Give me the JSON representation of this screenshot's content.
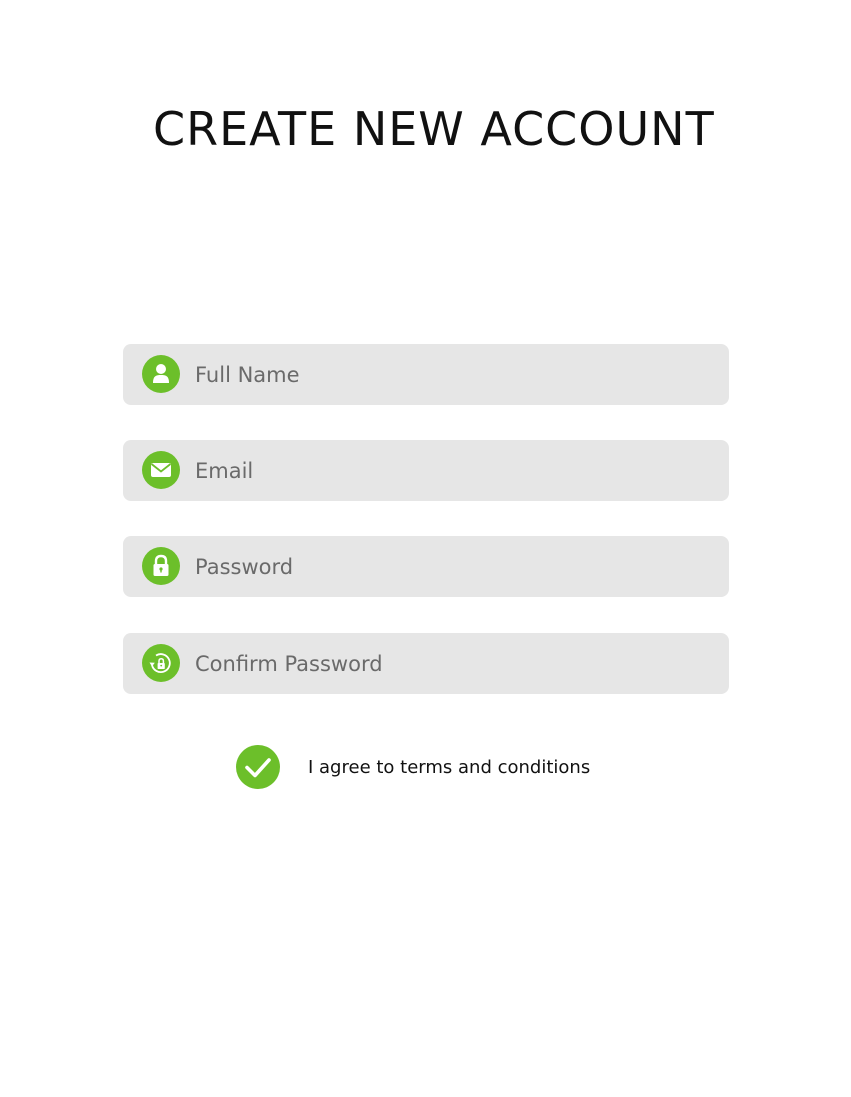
{
  "page": {
    "title": "CREATE NEW ACCOUNT"
  },
  "form": {
    "fields": [
      {
        "placeholder": "Full Name",
        "value": "",
        "icon": "user-icon"
      },
      {
        "placeholder": "Email",
        "value": "",
        "icon": "envelope-icon"
      },
      {
        "placeholder": "Password",
        "value": "",
        "icon": "lock-icon"
      },
      {
        "placeholder": "Confirm Password",
        "value": "",
        "icon": "lock-refresh-icon"
      }
    ],
    "agree": {
      "label": "I agree to terms and conditions",
      "checked": true,
      "icon": "checkmark-icon"
    }
  },
  "colors": {
    "accent": "#6cbf2a",
    "field_bg": "#e6e6e6",
    "title_text": "#111111",
    "placeholder_text": "#6a6a6a"
  }
}
